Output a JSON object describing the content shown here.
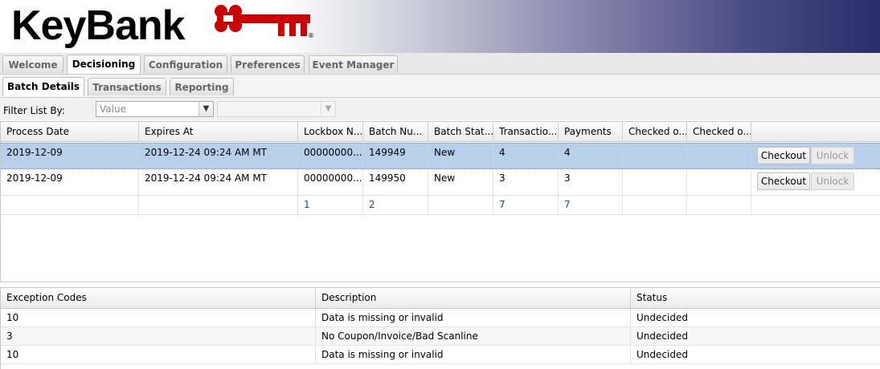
{
  "brand": {
    "name": "KeyBank",
    "registered": "®"
  },
  "main_tabs": [
    {
      "label": "Welcome",
      "active": false
    },
    {
      "label": "Decisioning",
      "active": true
    },
    {
      "label": "Configuration",
      "active": false
    },
    {
      "label": "Preferences",
      "active": false
    },
    {
      "label": "Event Manager",
      "active": false
    }
  ],
  "sub_tabs": [
    {
      "label": "Batch Details",
      "active": true
    },
    {
      "label": "Transactions",
      "active": false
    },
    {
      "label": "Reporting",
      "active": false
    }
  ],
  "filter": {
    "label": "Filter List By:",
    "field_value": "Value",
    "second_value": ""
  },
  "batch_grid": {
    "columns": [
      "Process Date",
      "Expires At",
      "Lockbox N...",
      "Batch Nu...",
      "Batch Stat...",
      "Transactio...",
      "Payments",
      "Checked o...",
      "Checked o..."
    ],
    "rows": [
      {
        "process_date": "2019-12-09",
        "expires_at": "2019-12-24 09:24 AM MT",
        "lockbox": "00000000...",
        "batch": "149949",
        "status": "New",
        "transactions": "4",
        "payments": "4",
        "checked_out_by": "",
        "checked_out_at": "",
        "checkout_label": "Checkout",
        "unlock_label": "Unlock",
        "selected": true
      },
      {
        "process_date": "2019-12-09",
        "expires_at": "2019-12-24 09:24 AM MT",
        "lockbox": "00000000...",
        "batch": "149950",
        "status": "New",
        "transactions": "3",
        "payments": "3",
        "checked_out_by": "",
        "checked_out_at": "",
        "checkout_label": "Checkout",
        "unlock_label": "Unlock",
        "selected": false
      }
    ],
    "summary": {
      "lockbox": "1",
      "batch": "2",
      "transactions": "7",
      "payments": "7"
    }
  },
  "exception_grid": {
    "columns": [
      "Exception Codes",
      "Description",
      "Status"
    ],
    "rows": [
      {
        "code": "10",
        "description": "Data is missing or invalid",
        "status": "Undecided"
      },
      {
        "code": "3",
        "description": "No Coupon/Invoice/Bad Scanline",
        "status": "Undecided"
      },
      {
        "code": "10",
        "description": "Data is missing or invalid",
        "status": "Undecided"
      }
    ]
  },
  "colors": {
    "brand_red": "#cc0000",
    "selection": "#b9d0ea",
    "banner_dark": "#2a2d6a"
  }
}
